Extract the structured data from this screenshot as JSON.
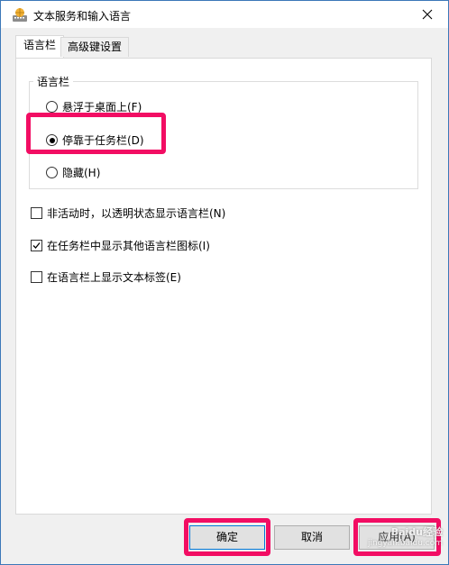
{
  "window": {
    "title": "文本服务和输入语言",
    "icons": {
      "app": "keyboard-globe-icon",
      "close": "close-icon"
    }
  },
  "tabs": [
    {
      "label": "语言栏",
      "active": true
    },
    {
      "label": "高级键设置",
      "active": false
    }
  ],
  "language_bar_group": {
    "legend": "语言栏",
    "options": [
      {
        "label": "悬浮于桌面上(F)",
        "checked": false
      },
      {
        "label": "停靠于任务栏(D)",
        "checked": true
      },
      {
        "label": "隐藏(H)",
        "checked": false
      }
    ]
  },
  "checkboxes": [
    {
      "label": "非活动时，以透明状态显示语言栏(N)",
      "checked": false
    },
    {
      "label": "在任务栏中显示其他语言栏图标(I)",
      "checked": true
    },
    {
      "label": "在语言栏上显示文本标签(E)",
      "checked": false
    }
  ],
  "buttons": {
    "ok": "确定",
    "cancel": "取消",
    "apply": "应用(A)"
  },
  "watermark": {
    "text": "Baidu经验",
    "url": "jingyan.baidu.com"
  },
  "colors": {
    "highlight": "#f20d63",
    "window_border": "#3c78b8",
    "ok_button_border": "#0078d7"
  }
}
